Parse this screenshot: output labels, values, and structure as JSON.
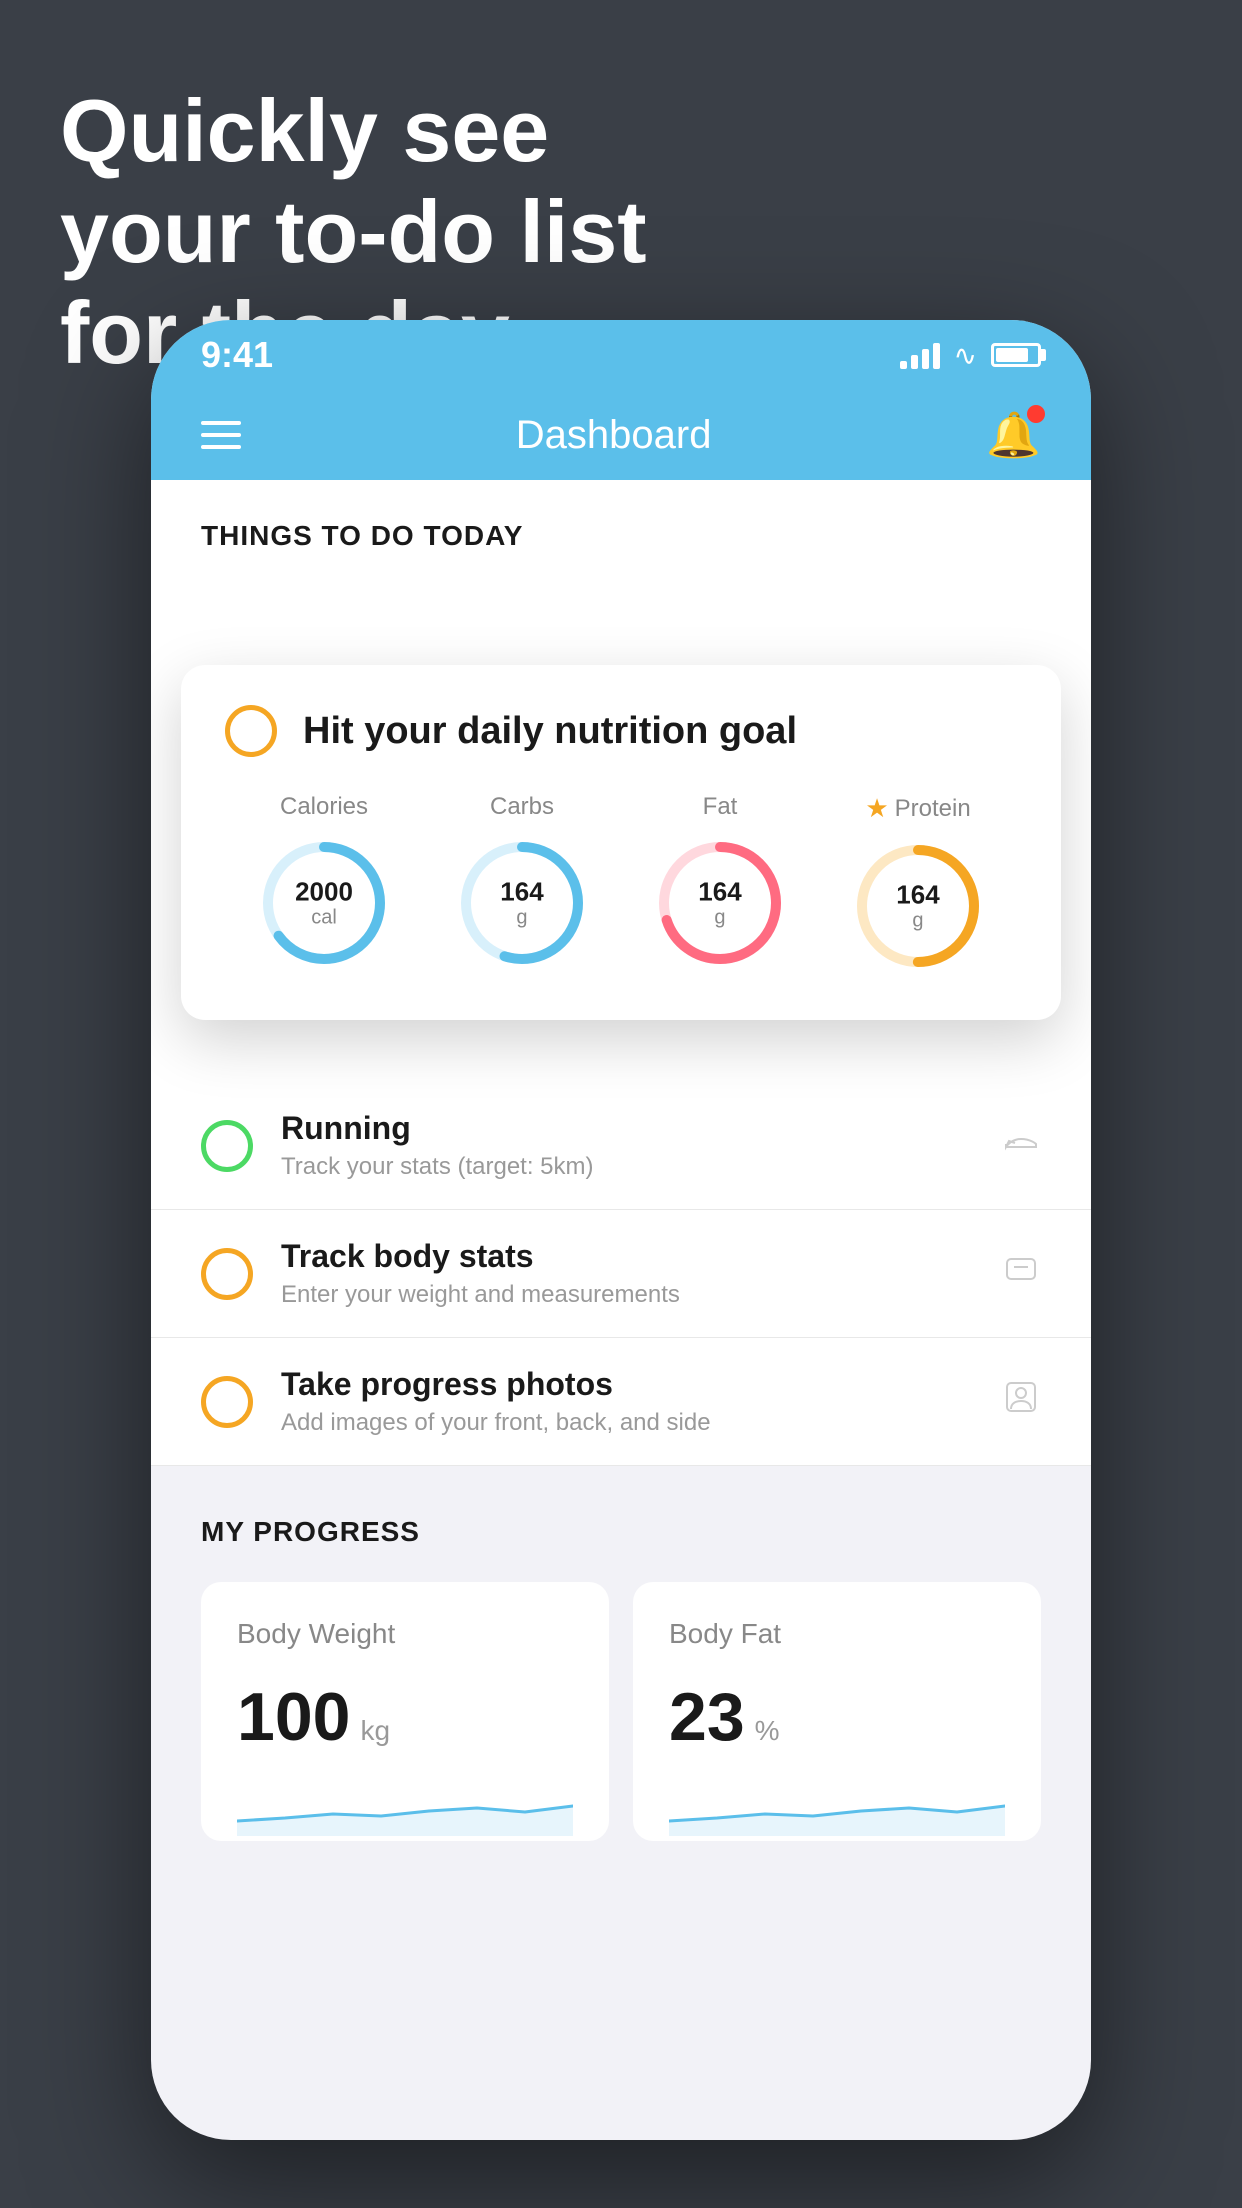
{
  "hero": {
    "line1": "Quickly see",
    "line2": "your to-do list",
    "line3": "for the day."
  },
  "phone": {
    "statusBar": {
      "time": "9:41"
    },
    "navBar": {
      "title": "Dashboard"
    },
    "sectionHeading": "THINGS TO DO TODAY",
    "floatingCard": {
      "checkboxColor": "yellow",
      "title": "Hit your daily nutrition goal",
      "nutrition": [
        {
          "label": "Calories",
          "value": "2000",
          "unit": "cal",
          "color": "#5bbfea",
          "trackColor": "#d8f0fb",
          "progress": 65,
          "starred": false
        },
        {
          "label": "Carbs",
          "value": "164",
          "unit": "g",
          "color": "#5bbfea",
          "trackColor": "#d8f0fb",
          "progress": 55,
          "starred": false
        },
        {
          "label": "Fat",
          "value": "164",
          "unit": "g",
          "color": "#ff6b81",
          "trackColor": "#ffd8de",
          "progress": 70,
          "starred": false
        },
        {
          "label": "Protein",
          "value": "164",
          "unit": "g",
          "color": "#f5a623",
          "trackColor": "#fde8c3",
          "progress": 50,
          "starred": true
        }
      ]
    },
    "todoItems": [
      {
        "id": "running",
        "circleColor": "green",
        "title": "Running",
        "subtitle": "Track your stats (target: 5km)",
        "icon": "shoe"
      },
      {
        "id": "track-body",
        "circleColor": "yellow",
        "title": "Track body stats",
        "subtitle": "Enter your weight and measurements",
        "icon": "scale"
      },
      {
        "id": "progress-photos",
        "circleColor": "yellow",
        "title": "Take progress photos",
        "subtitle": "Add images of your front, back, and side",
        "icon": "person"
      }
    ],
    "progressSection": {
      "heading": "MY PROGRESS",
      "cards": [
        {
          "title": "Body Weight",
          "value": "100",
          "unit": "kg"
        },
        {
          "title": "Body Fat",
          "value": "23",
          "unit": "%"
        }
      ]
    }
  }
}
